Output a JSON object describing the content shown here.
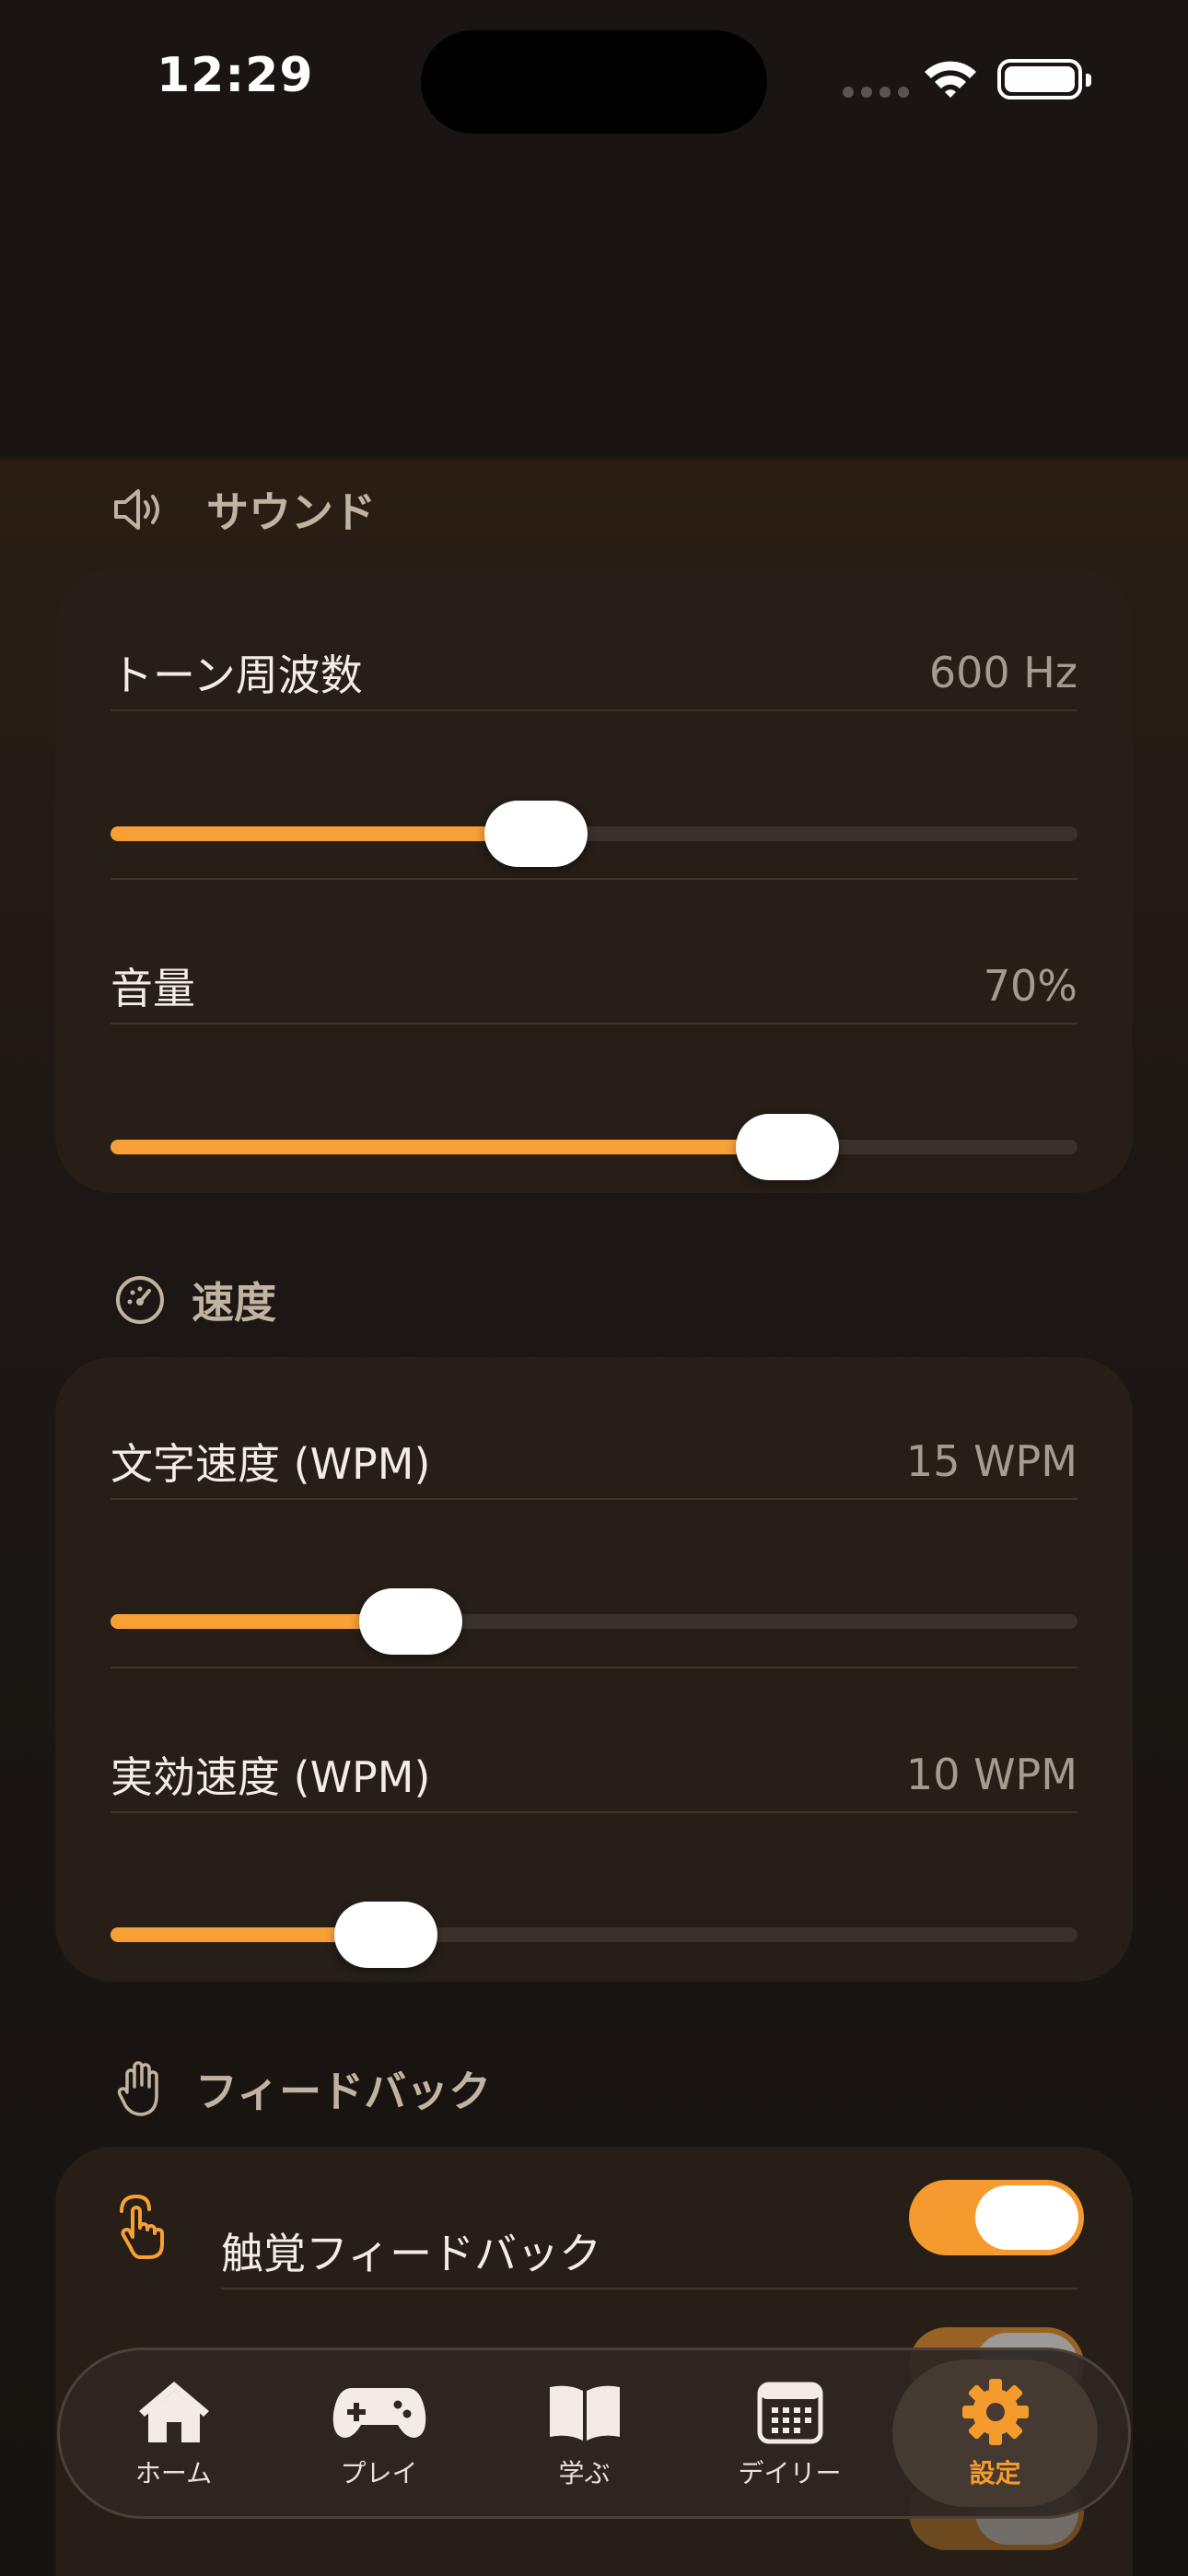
{
  "status_bar": {
    "time": "12:29"
  },
  "sections": {
    "sound": {
      "title": "サウンド",
      "tone": {
        "label": "トーン周波数",
        "value": "600 Hz",
        "level": 0.44
      },
      "volume": {
        "label": "音量",
        "value": "70%",
        "level": 0.7
      }
    },
    "speed": {
      "title": "速度",
      "char_speed": {
        "label": "文字速度 (WPM)",
        "value": "15 WPM",
        "level": 0.31
      },
      "effective_speed": {
        "label": "実効速度 (WPM)",
        "value": "10 WPM",
        "level": 0.285
      }
    },
    "feedback": {
      "title": "フィードバック",
      "haptic": {
        "label": "触覚フィードバック",
        "on": true
      }
    }
  },
  "tabbar": {
    "items": [
      {
        "label": "ホーム",
        "icon": "house-icon"
      },
      {
        "label": "プレイ",
        "icon": "gamecontroller-icon"
      },
      {
        "label": "学ぶ",
        "icon": "book-icon"
      },
      {
        "label": "デイリー",
        "icon": "calendar-icon"
      },
      {
        "label": "設定",
        "icon": "gear-icon",
        "active": true
      }
    ]
  },
  "colors": {
    "accent": "#f7a035",
    "card": "#261e17",
    "background": "#1a1512"
  }
}
